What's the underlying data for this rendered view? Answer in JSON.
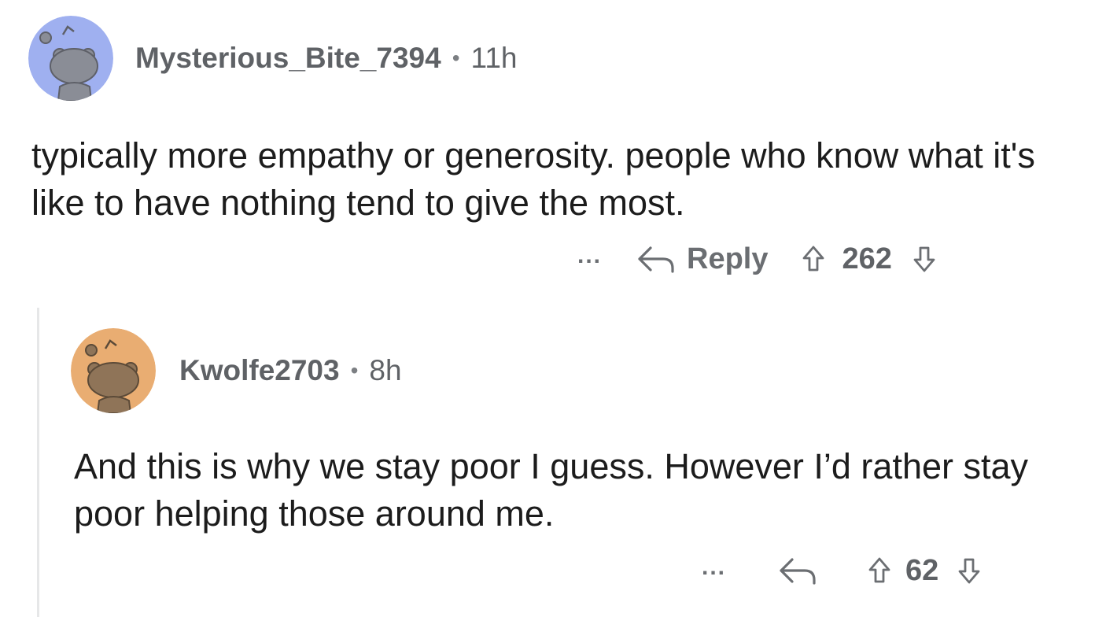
{
  "comments": [
    {
      "username": "Mysterious_Bite_7394",
      "separator": "•",
      "time": "11h",
      "body": "typically more empathy or generosity. people who know what it's like to have nothing tend to give the most.",
      "more": "...",
      "reply_label": "Reply",
      "votes": "262",
      "avatar_color": "#9fb0f0",
      "avatar_figure_color": "#8a8d96"
    },
    {
      "username": "Kwolfe2703",
      "separator": "•",
      "time": "8h",
      "body": "And this is why we stay poor I guess. However I’d rather stay poor helping those around me.",
      "more": "...",
      "votes": "62",
      "avatar_color": "#e9ad72",
      "avatar_figure_color": "#8f7458"
    }
  ],
  "icons": {
    "reply": "reply-arrow-icon",
    "upvote": "upvote-arrow-icon",
    "downvote": "downvote-arrow-icon",
    "more": "more-options-icon"
  }
}
